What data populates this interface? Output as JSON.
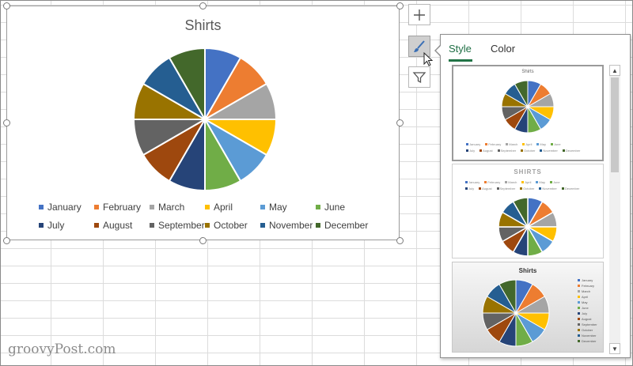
{
  "chart_data": {
    "type": "pie",
    "title": "Shirts",
    "categories": [
      "January",
      "February",
      "March",
      "April",
      "May",
      "June",
      "July",
      "August",
      "September",
      "October",
      "November",
      "December"
    ],
    "values": [
      1,
      1,
      1,
      1,
      1,
      1,
      1,
      1,
      1,
      1,
      1,
      1
    ],
    "colors": [
      "#4472c4",
      "#ed7d31",
      "#a5a5a5",
      "#ffc000",
      "#5b9bd5",
      "#70ad47",
      "#264478",
      "#9e480e",
      "#636363",
      "#997300",
      "#255e91",
      "#43682b"
    ],
    "legend_position": "bottom"
  },
  "buttons": {
    "add_elements_icon": "plus-icon",
    "styles_icon": "brush-icon",
    "filter_icon": "filter-icon"
  },
  "panel": {
    "tabs": [
      "Style",
      "Color"
    ],
    "active_tab": "Style",
    "thumb1_title": "Shirts",
    "thumb2_title": "SHIRTS",
    "thumb3_title": "Shirts",
    "scroll_up": "▲",
    "scroll_down": "▼"
  },
  "watermark": "groovyPost.com",
  "colors": {
    "accent": "#217346"
  }
}
